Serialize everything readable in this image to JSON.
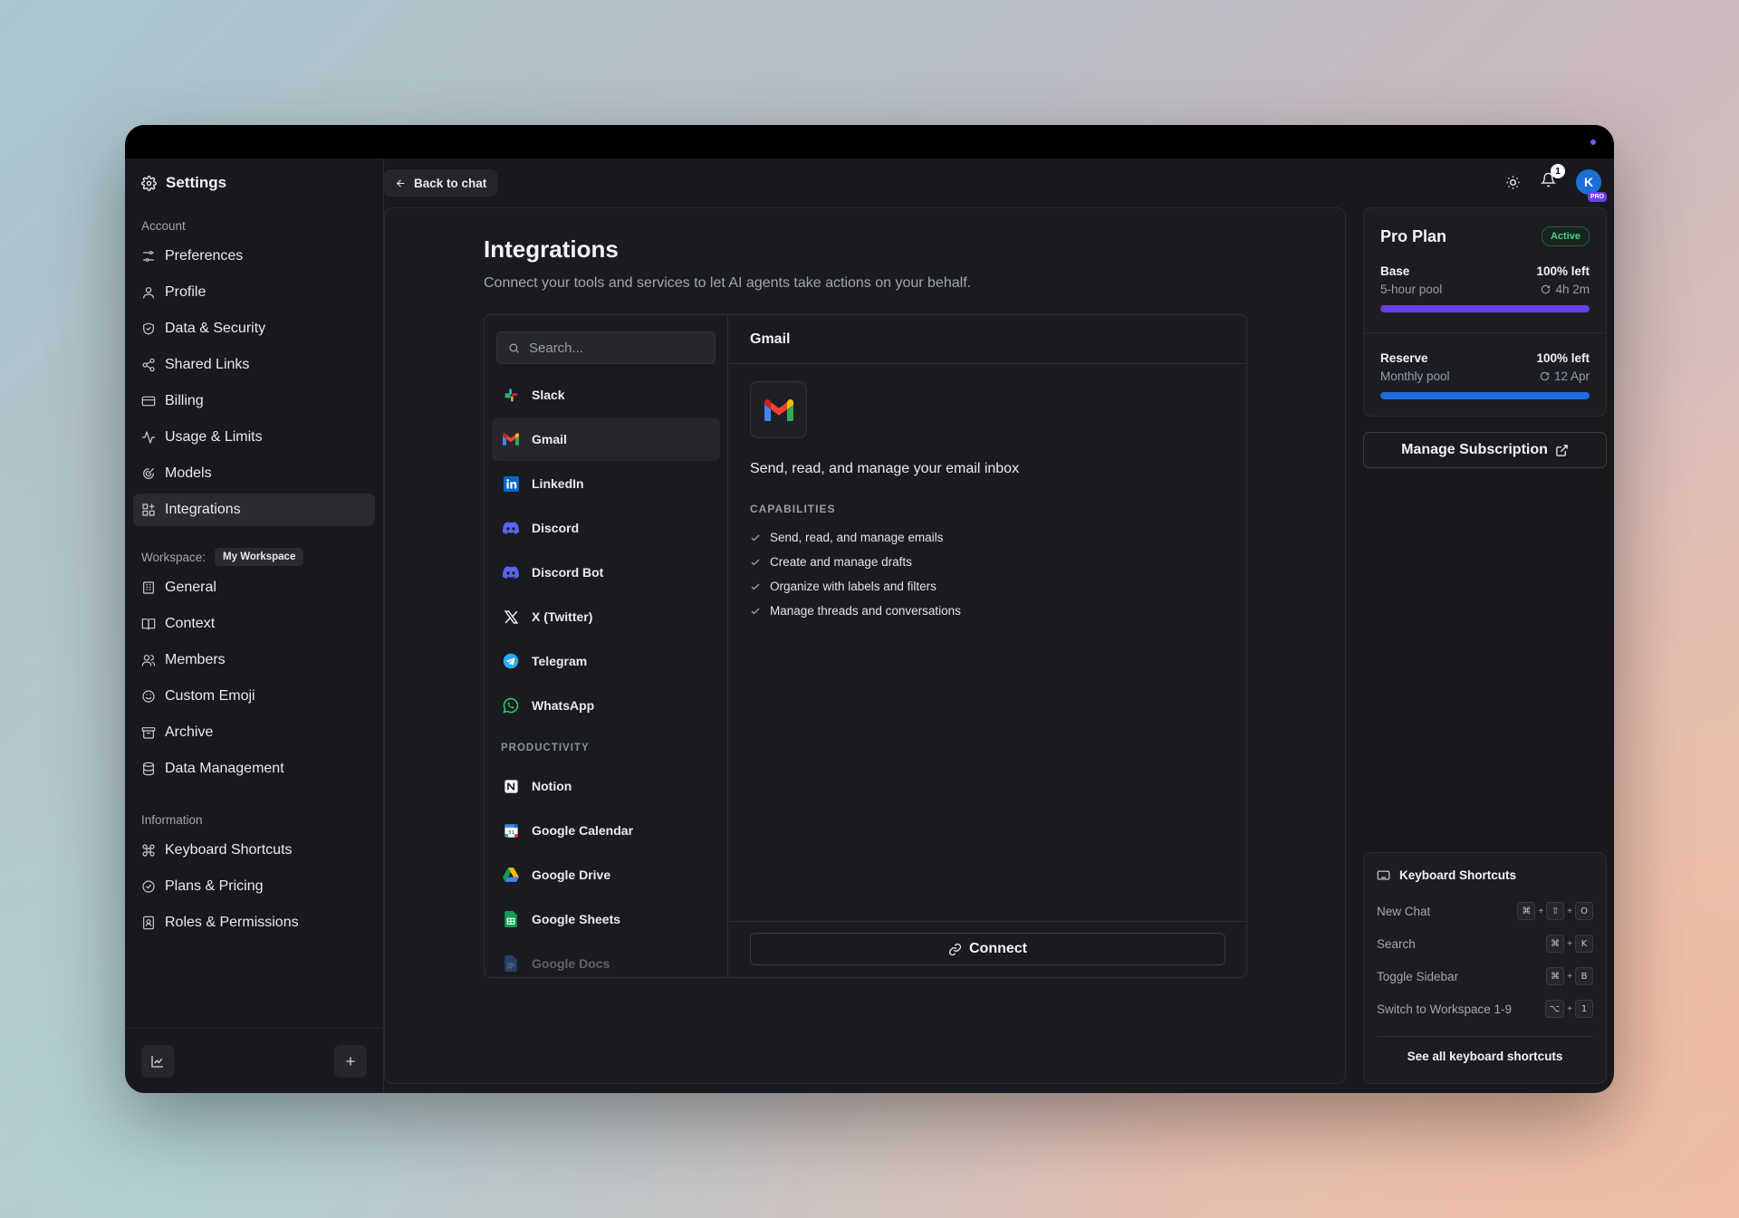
{
  "settings_title": "Settings",
  "back_label": "Back to chat",
  "notification_count": "1",
  "avatar": {
    "initial": "K",
    "tag": "PRO"
  },
  "sidebar": {
    "account_label": "Account",
    "account_items": [
      {
        "label": "Preferences",
        "icon": "sliders-icon"
      },
      {
        "label": "Profile",
        "icon": "user-icon"
      },
      {
        "label": "Data & Security",
        "icon": "shield-icon"
      },
      {
        "label": "Shared Links",
        "icon": "share-icon"
      },
      {
        "label": "Billing",
        "icon": "card-icon"
      },
      {
        "label": "Usage & Limits",
        "icon": "activity-icon"
      },
      {
        "label": "Models",
        "icon": "models-icon"
      },
      {
        "label": "Integrations",
        "icon": "grid-plus-icon"
      }
    ],
    "workspace_label": "Workspace:",
    "workspace_name": "My Workspace",
    "workspace_items": [
      {
        "label": "General",
        "icon": "building-icon"
      },
      {
        "label": "Context",
        "icon": "book-icon"
      },
      {
        "label": "Members",
        "icon": "users-icon"
      },
      {
        "label": "Custom Emoji",
        "icon": "smile-icon"
      },
      {
        "label": "Archive",
        "icon": "archive-icon"
      },
      {
        "label": "Data Management",
        "icon": "database-icon"
      }
    ],
    "info_label": "Information",
    "info_items": [
      {
        "label": "Keyboard Shortcuts",
        "icon": "command-icon"
      },
      {
        "label": "Plans & Pricing",
        "icon": "badge-check-icon"
      },
      {
        "label": "Roles & Permissions",
        "icon": "id-card-icon"
      }
    ]
  },
  "main": {
    "title": "Integrations",
    "subtitle": "Connect your tools and services to let AI agents take actions on your behalf.",
    "search_placeholder": "Search...",
    "integrations": [
      "Slack",
      "Gmail",
      "LinkedIn",
      "Discord",
      "Discord Bot",
      "X (Twitter)",
      "Telegram",
      "WhatsApp"
    ],
    "productivity_label": "PRODUCTIVITY",
    "productivity": [
      "Notion",
      "Google Calendar",
      "Google Drive",
      "Google Sheets",
      "Google Docs"
    ],
    "selected": {
      "name": "Gmail",
      "description": "Send, read, and manage your email inbox",
      "capabilities_label": "CAPABILITIES",
      "capabilities": [
        "Send, read, and manage emails",
        "Create and manage drafts",
        "Organize with labels and filters",
        "Manage threads and conversations"
      ],
      "connect_label": "Connect"
    }
  },
  "plan": {
    "name": "Pro Plan",
    "status": "Active",
    "pools": [
      {
        "name": "Base",
        "sub": "5-hour pool",
        "left": "100% left",
        "reset": "4h 2m",
        "fraction": 1.0,
        "color": "#6a3ff0"
      },
      {
        "name": "Reserve",
        "sub": "Monthly pool",
        "left": "100% left",
        "reset": "12 Apr",
        "fraction": 1.0,
        "color": "#1e6ddf"
      }
    ],
    "manage_label": "Manage Subscription"
  },
  "shortcuts": {
    "title": "Keyboard Shortcuts",
    "items": [
      {
        "label": "New Chat",
        "keys": [
          "⌘",
          "⇧",
          "O"
        ]
      },
      {
        "label": "Search",
        "keys": [
          "⌘",
          "K"
        ]
      },
      {
        "label": "Toggle Sidebar",
        "keys": [
          "⌘",
          "B"
        ]
      },
      {
        "label": "Switch to Workspace 1-9",
        "keys": [
          "⌥",
          "1"
        ]
      }
    ],
    "see_all": "See all keyboard shortcuts"
  }
}
